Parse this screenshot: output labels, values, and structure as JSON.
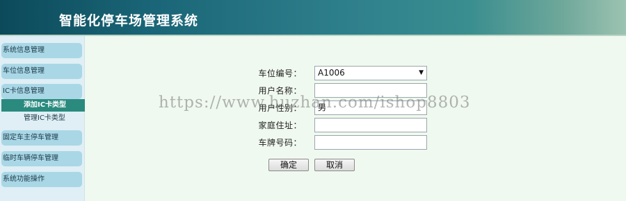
{
  "header": {
    "title": "智能化停车场管理系统"
  },
  "sidebar": {
    "items": [
      {
        "label": "系统信息管理"
      },
      {
        "label": "车位信息管理"
      },
      {
        "label": "IC卡信息管理"
      },
      {
        "label": "固定车主停车管理"
      },
      {
        "label": "临时车辆停车管理"
      },
      {
        "label": "系统功能操作"
      }
    ],
    "sub_items": [
      {
        "label": "添加IC卡类型",
        "active": true
      },
      {
        "label": "管理IC卡类型",
        "active": false
      }
    ]
  },
  "form": {
    "space_number": {
      "label": "车位编号：",
      "value": "A1006"
    },
    "user_name": {
      "label": "用户名称：",
      "value": ""
    },
    "user_gender": {
      "label": "用户性别：",
      "value": "男"
    },
    "home_address": {
      "label": "家庭住址：",
      "value": ""
    },
    "plate_number": {
      "label": "车牌号码：",
      "value": ""
    },
    "confirm_label": "确定",
    "cancel_label": "取消"
  },
  "watermark": "https://www.huzhan.com/ishop8803",
  "colors": {
    "header_start": "#0c4a5a",
    "header_end": "#9dc3b2",
    "sidebar_item": "#a9d7e6",
    "active_sub_item": "#2a8a7e",
    "content_bg": "#f0f9ef"
  },
  "icons": {
    "select_arrow": "triangle-down-icon"
  }
}
